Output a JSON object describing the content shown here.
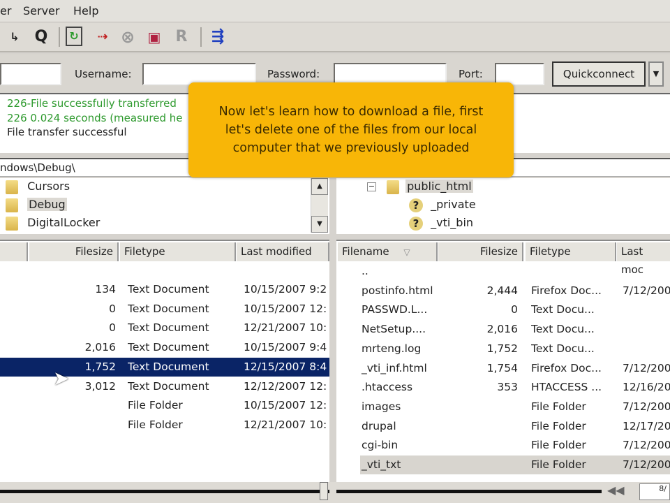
{
  "menu": {
    "items": [
      "er",
      "Server",
      "Help"
    ]
  },
  "toolbar": {
    "icons": [
      "process-queue-icon",
      "toggle-queue-icon",
      "refresh-icon",
      "cancel-icon",
      "stop-icon",
      "disconnect-icon",
      "reconnect-icon",
      "compare-icon"
    ],
    "q_glyph": "Q",
    "r_glyph": "R"
  },
  "quickconnect": {
    "host": "",
    "username_label": "Username:",
    "username": "",
    "password_label": "Password:",
    "password": "",
    "port_label": "Port:",
    "port": "",
    "button": "Quickconnect",
    "dropdown": "▼"
  },
  "log": {
    "lines": [
      {
        "text": "226-File successfully transferred",
        "color": "#2e9a2e"
      },
      {
        "text": "226 0.024 seconds (measured he",
        "color": "#2e9a2e"
      },
      {
        "text": "File transfer successful",
        "color": "#222222"
      }
    ]
  },
  "local": {
    "path": "ndows\\Debug\\",
    "tree": [
      "Cursors",
      "Debug",
      "DigitalLocker"
    ],
    "headers": {
      "filesize": "Filesize",
      "filetype": "Filetype",
      "modified": "Last modified"
    },
    "rows": [
      {
        "size": "134",
        "type": "Text Document",
        "modified": "10/15/2007 9:2"
      },
      {
        "size": "0",
        "type": "Text Document",
        "modified": "10/15/2007 12:"
      },
      {
        "size": "0",
        "type": "Text Document",
        "modified": "12/21/2007 10:"
      },
      {
        "size": "2,016",
        "type": "Text Document",
        "modified": "10/15/2007 9:4"
      },
      {
        "size": "1,752",
        "type": "Text Document",
        "modified": "12/15/2007 8:4",
        "selected": true
      },
      {
        "size": "3,012",
        "type": "Text Document",
        "modified": "12/12/2007 12:"
      },
      {
        "size": "",
        "type": "File Folder",
        "modified": "10/15/2007 12:"
      },
      {
        "size": "",
        "type": "File Folder",
        "modified": "12/21/2007 10:"
      }
    ]
  },
  "remote": {
    "tree": [
      {
        "name": "public_html",
        "icon": "folder"
      },
      {
        "name": "_private",
        "icon": "unknown"
      },
      {
        "name": "_vti_bin",
        "icon": "unknown"
      }
    ],
    "expander": "−",
    "headers": {
      "filename": "Filename",
      "sort": "▽",
      "filesize": "Filesize",
      "filetype": "Filetype",
      "modified": "Last moc"
    },
    "rows": [
      {
        "name": "..",
        "size": "",
        "type": "",
        "modified": "",
        "icon": "folder"
      },
      {
        "name": "postinfo.html",
        "size": "2,444",
        "type": "Firefox Doc...",
        "modified": "7/12/200",
        "icon": "firefox"
      },
      {
        "name": "PASSWD.L...",
        "size": "0",
        "type": "Text Docu...",
        "modified": "",
        "icon": "file"
      },
      {
        "name": "NetSetup....",
        "size": "2,016",
        "type": "Text Docu...",
        "modified": "",
        "icon": "file"
      },
      {
        "name": "mrteng.log",
        "size": "1,752",
        "type": "Text Docu...",
        "modified": "",
        "icon": "file"
      },
      {
        "name": "_vti_inf.html",
        "size": "1,754",
        "type": "Firefox Doc...",
        "modified": "7/12/200",
        "icon": "firefox"
      },
      {
        "name": ".htaccess",
        "size": "353",
        "type": "HTACCESS ...",
        "modified": "12/16/20",
        "icon": "file"
      },
      {
        "name": "images",
        "size": "",
        "type": "File Folder",
        "modified": "7/12/200",
        "icon": "folder"
      },
      {
        "name": "drupal",
        "size": "",
        "type": "File Folder",
        "modified": "12/17/20",
        "icon": "folder"
      },
      {
        "name": "cgi-bin",
        "size": "",
        "type": "File Folder",
        "modified": "7/12/200",
        "icon": "folder"
      },
      {
        "name": "_vti_txt",
        "size": "",
        "type": "File Folder",
        "modified": "7/12/200",
        "icon": "folder",
        "highlighted": true
      }
    ]
  },
  "status": {
    "queue_nav": "◀◀",
    "page": "8/"
  },
  "tooltip": {
    "lines": [
      "Now let's learn how to download a file, first",
      "let's delete one of the files from our local",
      "computer that we previously uploaded"
    ],
    "color": "#f8b607"
  }
}
